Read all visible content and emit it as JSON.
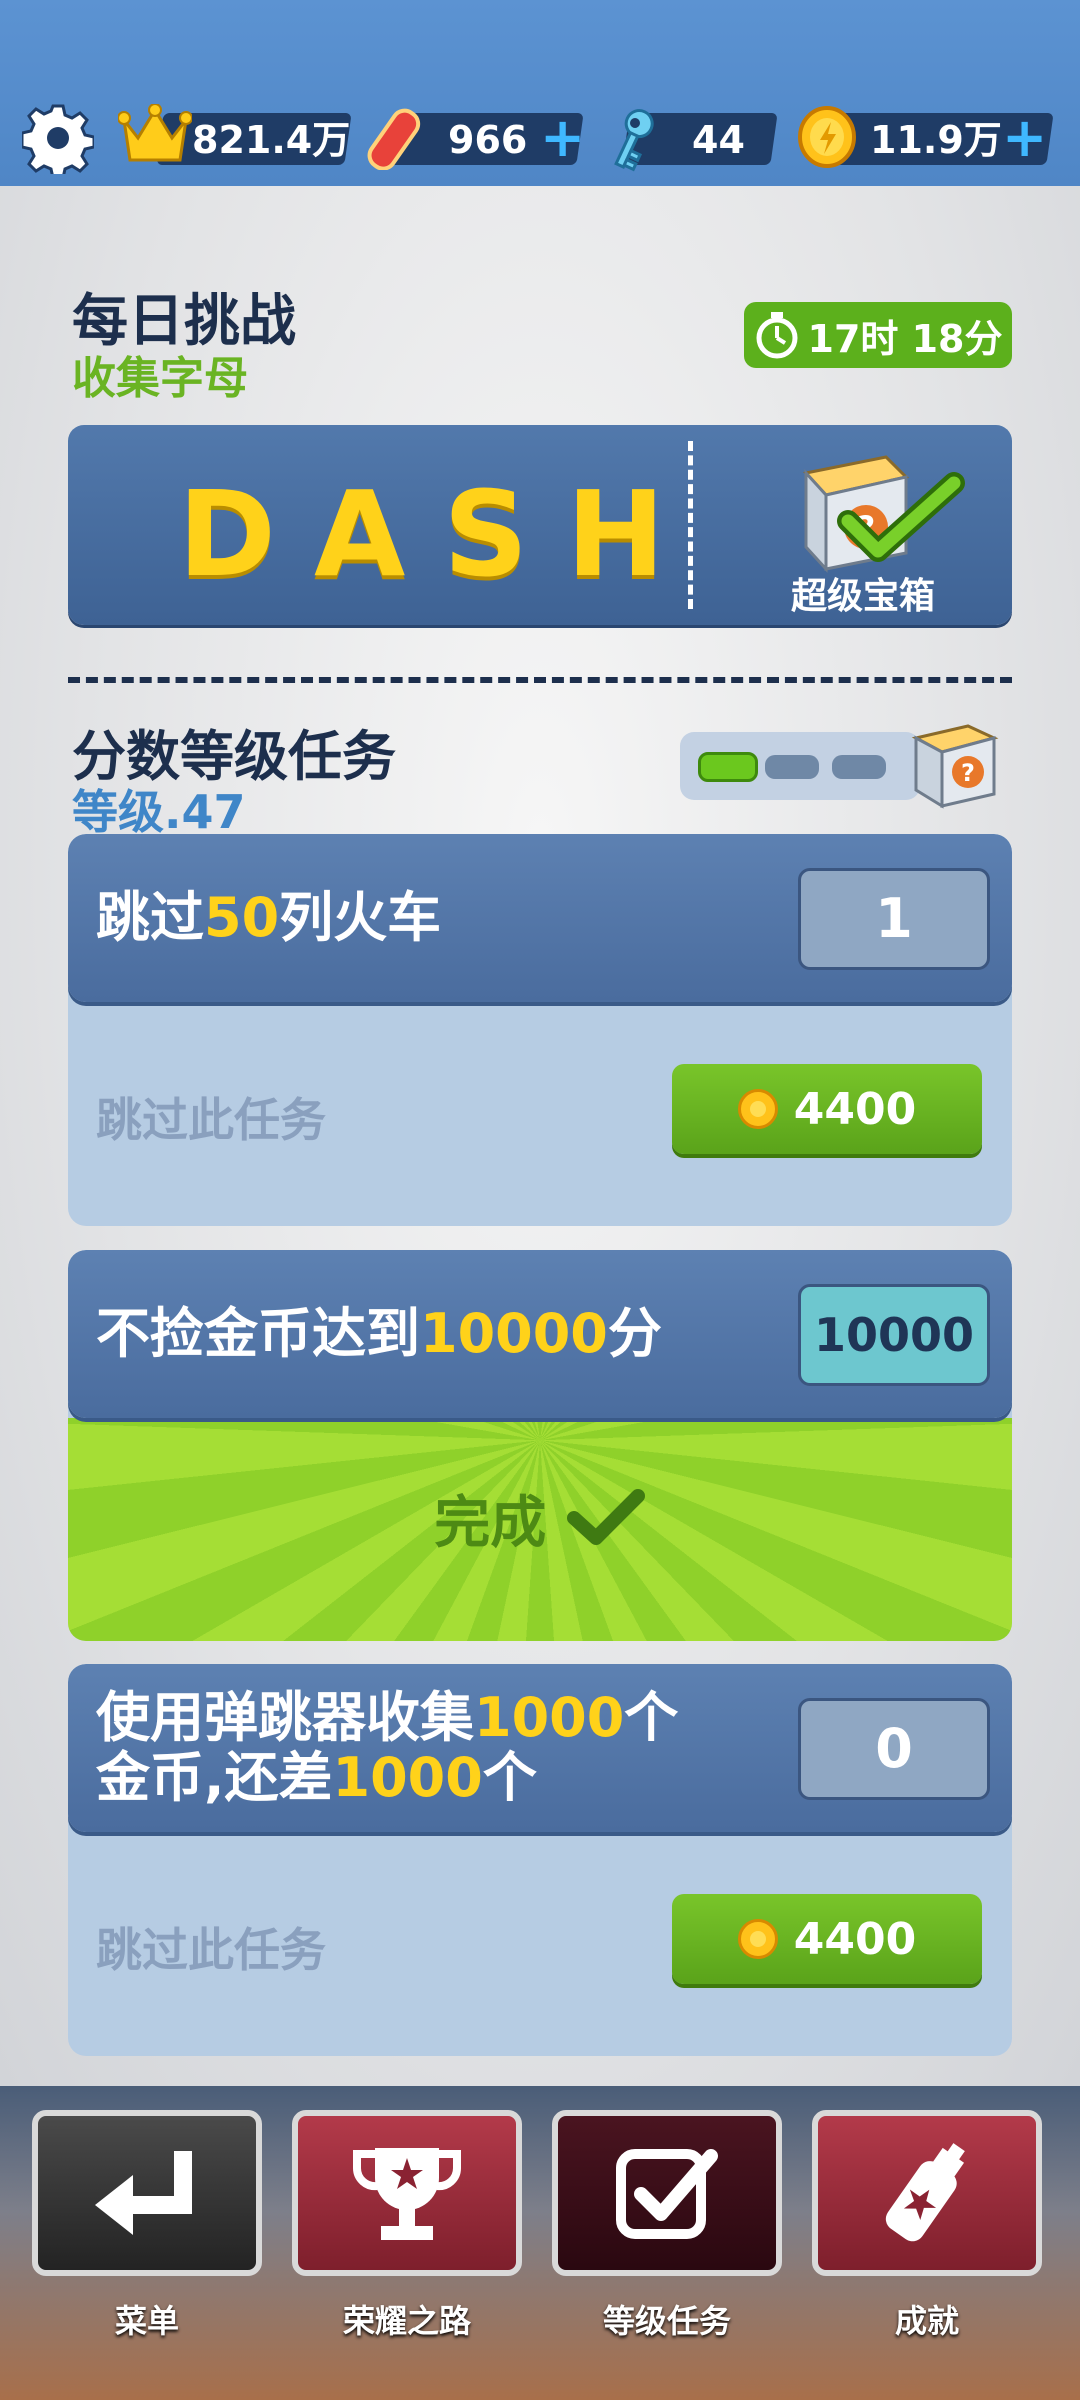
{
  "topbar": {
    "score": "821.4万",
    "boards": "966",
    "keys": "44",
    "coins": "11.9万",
    "plus": "+"
  },
  "daily": {
    "title": "每日挑战",
    "subtitle": "收集字母",
    "timer": "17时 18分",
    "word": "DASH",
    "chest_label": "超级宝箱"
  },
  "missions": {
    "title": "分数等级任务",
    "level": "等级.47",
    "progress_completed": 1,
    "progress_total": 3,
    "tasks": [
      {
        "pre": "跳过",
        "hl": "50",
        "post": "列火车",
        "count": "1",
        "skip": "跳过此任务",
        "cost": "4400"
      },
      {
        "pre": "不捡金币达到",
        "hl": "10000",
        "post": "分",
        "count": "10000",
        "done": "完成"
      },
      {
        "line1_pre": "使用弹跳器收集",
        "line1_hl": "1000",
        "line1_post": "个",
        "line2_pre": "金币,还差",
        "line2_hl": "1000",
        "line2_post": "个",
        "count": "0",
        "skip": "跳过此任务",
        "cost": "4400"
      }
    ]
  },
  "nav": {
    "menu": "菜单",
    "glory": "荣耀之路",
    "missions": "等级任务",
    "achievements": "成就"
  },
  "colors": {
    "accent_green": "#5cb01c",
    "highlight_yellow": "#ffd21a",
    "card_blue": "#4a6c9e"
  }
}
